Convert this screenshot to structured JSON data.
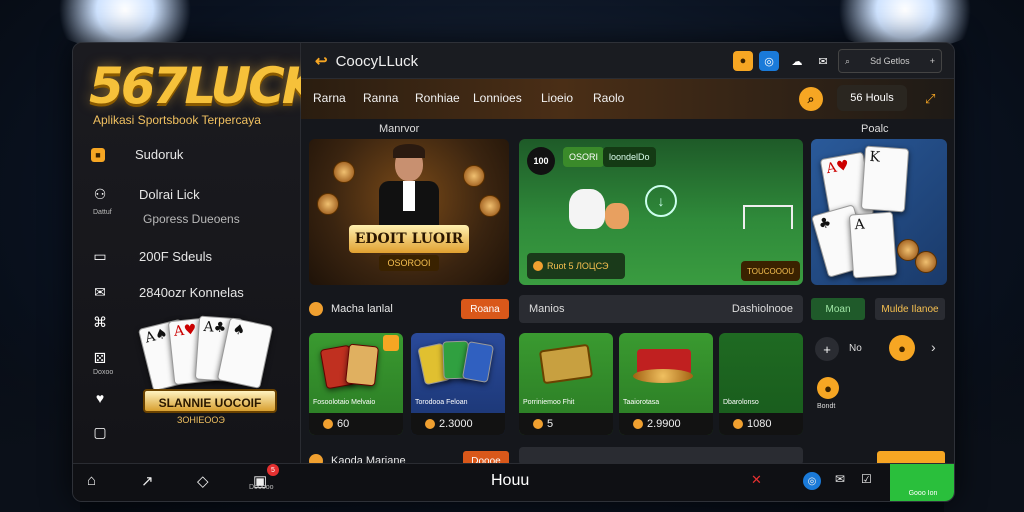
{
  "sidebar": {
    "logo": "567LUCK",
    "tagline": "Aplikasi Sportsbook Terpercaya",
    "items": [
      {
        "label": "Sudoruk",
        "icon": "bag-icon",
        "mini": ""
      },
      {
        "label": "Dolrai Lick",
        "icon": "person-icon",
        "mini": "Dattuf"
      },
      {
        "label": "Gporess Dueoens",
        "icon": "",
        "mini": ""
      },
      {
        "label": "200F Sdeuls",
        "icon": "monitor-icon",
        "mini": ""
      },
      {
        "label": "2840ozr Konnelas",
        "icon": "chat-icon",
        "mini": ""
      },
      {
        "label": "",
        "icon": "network-icon",
        "mini": ""
      },
      {
        "label": "",
        "icon": "dice-icon",
        "mini": "Doxoo"
      },
      {
        "label": "",
        "icon": "heart-icon",
        "mini": ""
      },
      {
        "label": "",
        "icon": "wallet-icon",
        "mini": ""
      }
    ],
    "slot_banner": "SLANNIE UOCOIF",
    "slot_sub": "ЗОНІЕООЭ"
  },
  "topbar": {
    "brand": "CoocyLLuck",
    "search_label": "Sd Getlos",
    "search_plus": "+"
  },
  "nav": {
    "tabs": [
      "Rarna",
      "Ranna",
      "Ronhiae",
      "Lonnioes",
      "Lioeio",
      "Raolo"
    ],
    "pill_label": "56 Houls"
  },
  "sections": {
    "left_label": "Manrvor",
    "right_label": "Poalc",
    "row1_title": "Macha lanlal",
    "row1_button": "Roana",
    "row1_field_left": "Manios",
    "row1_field_right": "Dashiolnooe",
    "row1_green_button": "Moan",
    "row1_orange_text": "Mulde Ilanoe",
    "row2_title": "Kaoda Mariane",
    "row2_button": "Doooe"
  },
  "banners": {
    "b1_title": "EDOIT LUOIR",
    "b1_sub": "OSOROOI",
    "b2_badge": "100",
    "b2_pill1": "OSORI",
    "b2_pill2": "loondelDo",
    "b2_bottom": "Ruot 5 ЛОЦСЭ",
    "b2_corner": "TOUCOOOU"
  },
  "games": [
    {
      "name": "Fosoolotaio Melvaio",
      "value": "60"
    },
    {
      "name": "Torodooa Feloan",
      "value": "2.3000"
    },
    {
      "name": "Porriniemoo Fhit",
      "value": "5"
    },
    {
      "name": "Taaiorotasa",
      "value": "2.9900"
    },
    {
      "name": "Dbarolonso",
      "value": "1080"
    }
  ],
  "right_panel": {
    "plus_label": "+",
    "x_label": "No",
    "extra": "Bondt"
  },
  "bottombar": {
    "home": "Houu",
    "item4_label": "Dooooo",
    "badge": "5",
    "green_label": "Gooo Ion"
  }
}
